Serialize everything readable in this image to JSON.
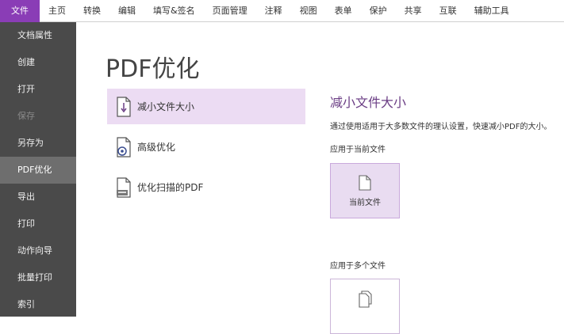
{
  "menubar": {
    "tabs": [
      "文件",
      "主页",
      "转换",
      "编辑",
      "填写&签名",
      "页面管理",
      "注释",
      "视图",
      "表单",
      "保护",
      "共享",
      "互联",
      "辅助工具"
    ]
  },
  "sidebar": {
    "items": [
      "文档属性",
      "创建",
      "打开",
      "保存",
      "另存为",
      "PDF优化",
      "导出",
      "打印",
      "动作向导",
      "批量打印",
      "索引"
    ]
  },
  "page": {
    "title": "PDF优化"
  },
  "options": [
    {
      "label": "减小文件大小"
    },
    {
      "label": "高级优化"
    },
    {
      "label": "优化扫描的PDF"
    }
  ],
  "panel": {
    "title": "减小文件大小",
    "description": "通过使用适用于大多数文件的理认设置，快速减小PDF的大小。",
    "current_section": "应用于当前文件",
    "current_button": "当前文件",
    "multi_section": "应用于多个文件"
  },
  "colors": {
    "accent": "#8a3db6",
    "sidebar": "#4a4a4a",
    "selected_option": "#ecdcf3"
  }
}
